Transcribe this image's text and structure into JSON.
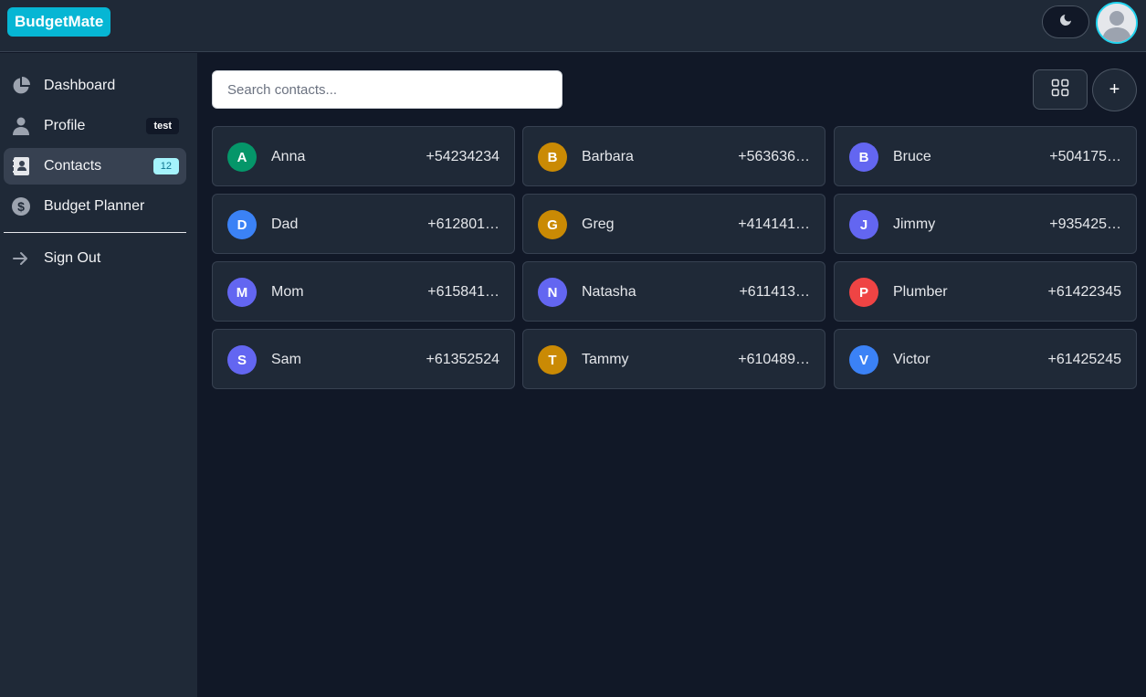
{
  "app": {
    "logo": "BudgetMate"
  },
  "header": {
    "theme_icon": "moon-icon",
    "avatar_icon": "user-avatar-icon"
  },
  "sidebar": {
    "items": [
      {
        "label": "Dashboard",
        "icon": "pie-chart-icon",
        "badge": ""
      },
      {
        "label": "Profile",
        "icon": "user-icon",
        "badge": "test"
      },
      {
        "label": "Contacts",
        "icon": "address-book-icon",
        "badge": "12",
        "active": true
      },
      {
        "label": "Budget Planner",
        "icon": "dollar-circle-icon",
        "badge": ""
      },
      {
        "label": "Sign Out",
        "icon": "arrow-right-icon",
        "badge": ""
      }
    ]
  },
  "main": {
    "search": {
      "placeholder": "Search contacts...",
      "value": ""
    },
    "grid_icon": "grid-view-icon",
    "add_label": "+",
    "contacts": [
      {
        "initial": "A",
        "name": "Anna",
        "phone": "+54234234",
        "color": "#059669"
      },
      {
        "initial": "B",
        "name": "Barbara",
        "phone": "+563636…",
        "color": "#ca8a04"
      },
      {
        "initial": "B",
        "name": "Bruce",
        "phone": "+504175…",
        "color": "#6366f1"
      },
      {
        "initial": "D",
        "name": "Dad",
        "phone": "+612801…",
        "color": "#3b82f6"
      },
      {
        "initial": "G",
        "name": "Greg",
        "phone": "+414141…",
        "color": "#ca8a04"
      },
      {
        "initial": "J",
        "name": "Jimmy",
        "phone": "+935425…",
        "color": "#6366f1"
      },
      {
        "initial": "M",
        "name": "Mom",
        "phone": "+615841…",
        "color": "#6366f1"
      },
      {
        "initial": "N",
        "name": "Natasha",
        "phone": "+611413…",
        "color": "#6366f1"
      },
      {
        "initial": "P",
        "name": "Plumber",
        "phone": "+61422345",
        "color": "#ef4444"
      },
      {
        "initial": "S",
        "name": "Sam",
        "phone": "+61352524",
        "color": "#6366f1"
      },
      {
        "initial": "T",
        "name": "Tammy",
        "phone": "+610489…",
        "color": "#ca8a04"
      },
      {
        "initial": "V",
        "name": "Victor",
        "phone": "+61425245",
        "color": "#3b82f6"
      }
    ]
  }
}
